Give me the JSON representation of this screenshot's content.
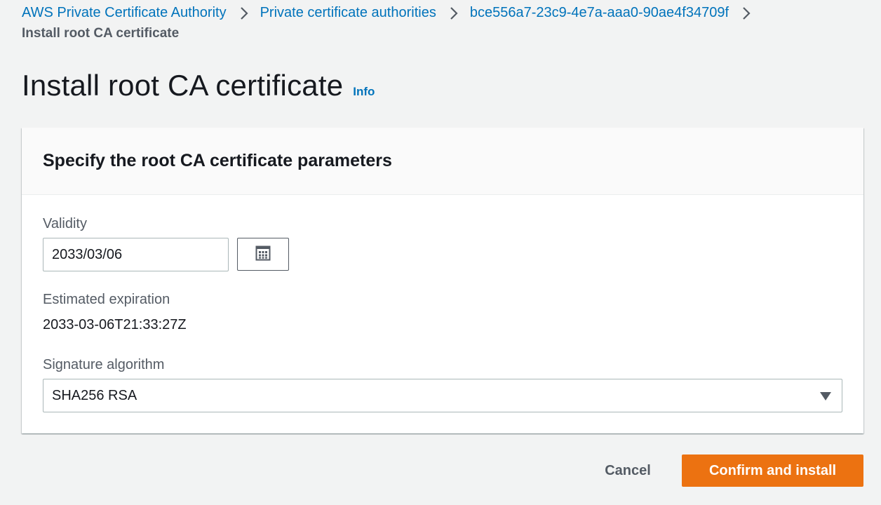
{
  "breadcrumb": {
    "items": [
      {
        "label": "AWS Private Certificate Authority"
      },
      {
        "label": "Private certificate authorities"
      },
      {
        "label": "bce556a7-23c9-4e7a-aaa0-90ae4f34709f"
      }
    ],
    "current": "Install root CA certificate"
  },
  "header": {
    "title": "Install root CA certificate",
    "info_label": "Info"
  },
  "panel": {
    "title": "Specify the root CA certificate parameters",
    "validity": {
      "label": "Validity",
      "value": "2033/03/06"
    },
    "calendar_icon": "calendar-icon",
    "expiration": {
      "label": "Estimated expiration",
      "value": "2033-03-06T21:33:27Z"
    },
    "signature": {
      "label": "Signature algorithm",
      "selected": "SHA256 RSA"
    }
  },
  "actions": {
    "cancel_label": "Cancel",
    "confirm_label": "Confirm and install"
  },
  "colors": {
    "link": "#0073bb",
    "primary_button": "#ec7211",
    "background": "#f2f3f3"
  }
}
